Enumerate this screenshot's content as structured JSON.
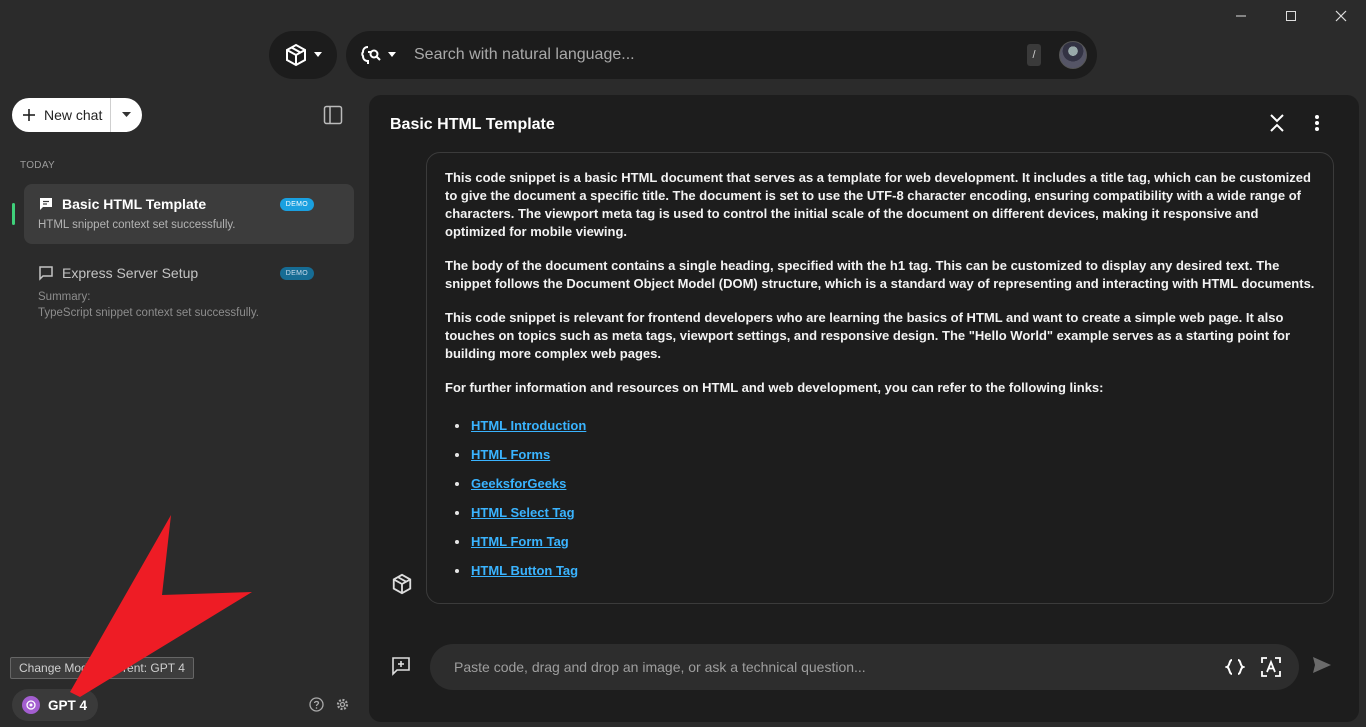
{
  "search": {
    "placeholder": "Search with natural language...",
    "shortcut": "/"
  },
  "sidebar": {
    "new_chat_label": "New chat",
    "section_label": "TODAY",
    "items": [
      {
        "title": "Basic HTML Template",
        "badge": "DEMO",
        "subtitle": "HTML snippet context set successfully."
      },
      {
        "title": "Express Server Setup",
        "badge": "DEMO",
        "subtitle_line1": "Summary:",
        "subtitle_line2": "TypeScript snippet context set successfully."
      }
    ],
    "tooltip": "Change Model. Current: GPT 4",
    "model_label": "GPT 4"
  },
  "chat": {
    "title": "Basic HTML Template",
    "paragraphs": [
      "This code snippet is a basic HTML document that serves as a template for web development. It includes a title tag, which can be customized to give the document a specific title. The document is set to use the UTF-8 character encoding, ensuring compatibility with a wide range of characters. The viewport meta tag is used to control the initial scale of the document on different devices, making it responsive and optimized for mobile viewing.",
      "The body of the document contains a single heading, specified with the h1 tag. This can be customized to display any desired text. The snippet follows the Document Object Model (DOM) structure, which is a standard way of representing and interacting with HTML documents.",
      "This code snippet is relevant for frontend developers who are learning the basics of HTML and want to create a simple web page. It also touches on topics such as meta tags, viewport settings, and responsive design. The \"Hello World\" example serves as a starting point for building more complex web pages.",
      "For further information and resources on HTML and web development, you can refer to the following links:"
    ],
    "links": [
      "HTML Introduction",
      "HTML Forms",
      "GeeksforGeeks",
      "HTML Select Tag",
      "HTML Form Tag",
      "HTML Button Tag"
    ]
  },
  "composer": {
    "placeholder": "Paste code, drag and drop an image, or ask a technical question..."
  },
  "colors": {
    "background": "#2b2b2b",
    "panel": "#1d1d1d",
    "link": "#3ab4ff",
    "badge": "#1aa0e0",
    "active_marker": "#3fd07a",
    "annotation_arrow": "#ee1c25"
  }
}
